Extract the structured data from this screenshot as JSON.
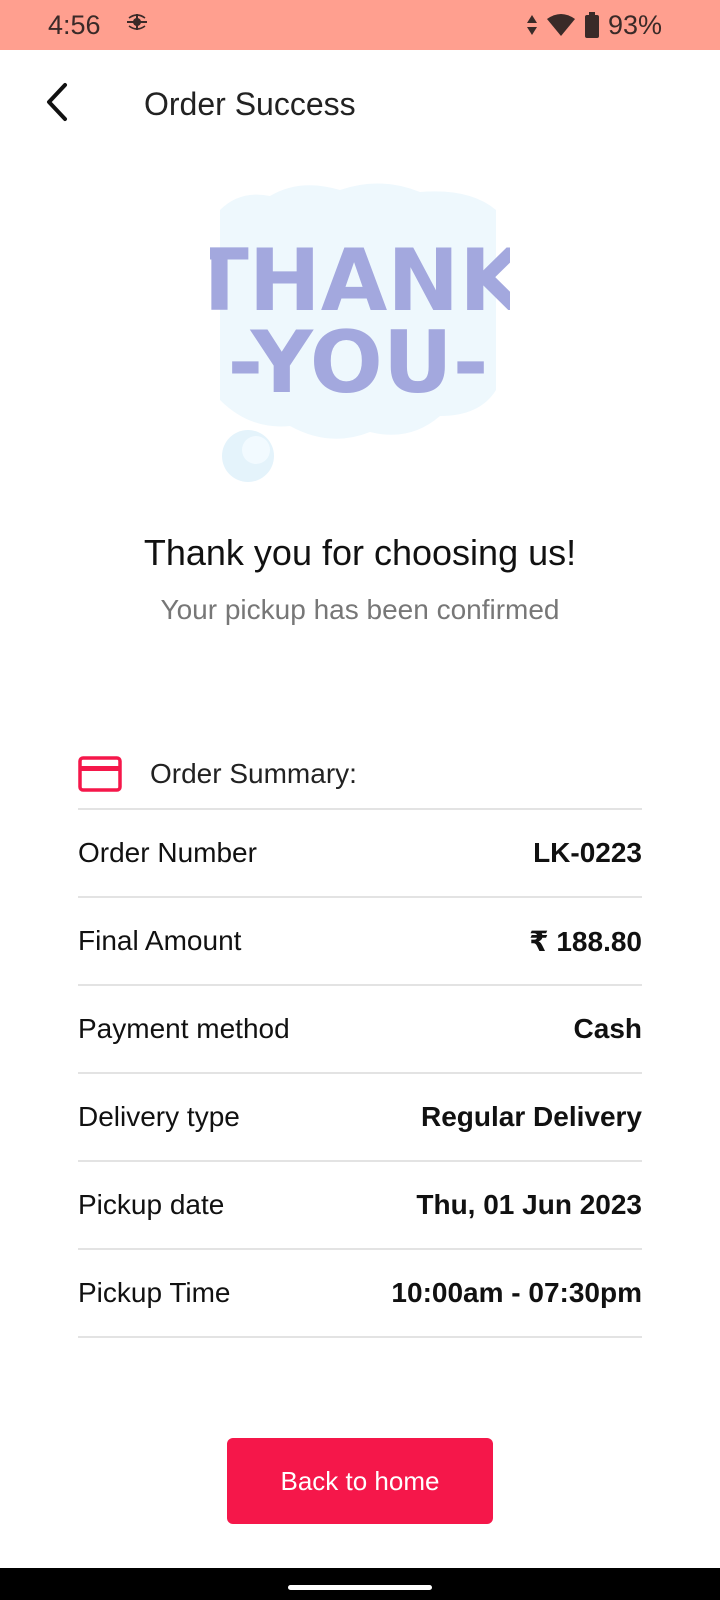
{
  "status_bar": {
    "time": "4:56",
    "battery": "93%"
  },
  "app_bar": {
    "title": "Order Success"
  },
  "hero": {
    "line1": "THANK",
    "line2": "-YOU-"
  },
  "message": {
    "title": "Thank you for choosing us!",
    "subtitle": "Your pickup has been confirmed"
  },
  "summary": {
    "header": "Order Summary:",
    "rows": [
      {
        "label": "Order Number",
        "value": "LK-0223"
      },
      {
        "label": "Final Amount",
        "value": "₹ 188.80"
      },
      {
        "label": "Payment method",
        "value": "Cash"
      },
      {
        "label": "Delivery type",
        "value": "Regular Delivery"
      },
      {
        "label": "Pickup date",
        "value": "Thu, 01 Jun 2023"
      },
      {
        "label": "Pickup Time",
        "value": "10:00am - 07:30pm"
      }
    ]
  },
  "button": {
    "label": "Back to home"
  },
  "colors": {
    "accent": "#f5174a",
    "status_bar": "#ff9f8f",
    "hero_text": "#a3a8de",
    "cloud": "#eef8fd"
  }
}
